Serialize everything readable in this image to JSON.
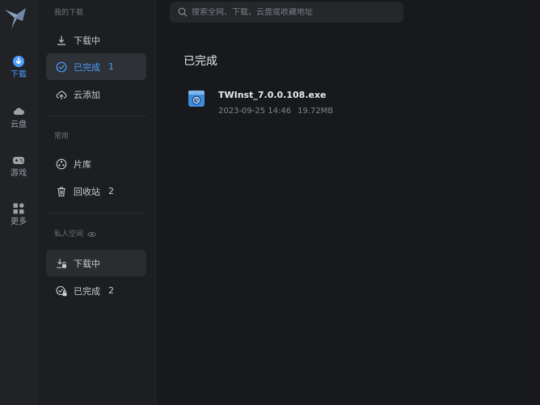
{
  "rail": {
    "items": [
      {
        "label": "下载",
        "icon": "download-icon"
      },
      {
        "label": "云盘",
        "icon": "cloud-icon"
      },
      {
        "label": "游戏",
        "icon": "gamepad-icon"
      },
      {
        "label": "更多",
        "icon": "grid-icon"
      }
    ],
    "active_color": "#4d9cff"
  },
  "side": {
    "my_downloads_title": "我的下载",
    "downloading_label": "下载中",
    "completed_label": "已完成",
    "completed_count": "1",
    "cloud_add_label": "云添加",
    "common_title": "常用",
    "library_label": "片库",
    "recycle_label": "回收站",
    "recycle_count": "2",
    "private_title": "私人空间",
    "private_downloading_label": "下载中",
    "private_completed_label": "已完成",
    "private_completed_count": "2"
  },
  "search": {
    "placeholder": "搜索全网、下载、云盘或收藏地址"
  },
  "main": {
    "title": "已完成",
    "files": [
      {
        "name": "TWInst_7.0.0.108.exe",
        "date": "2023-09-25 14:46",
        "size": "19.72MB",
        "icon": "installer-icon"
      }
    ]
  }
}
